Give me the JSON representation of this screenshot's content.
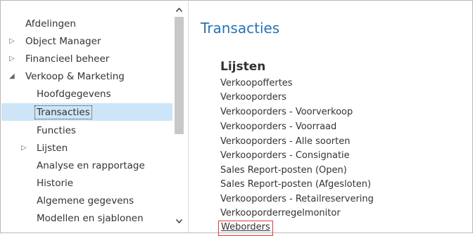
{
  "sidebar": {
    "items": [
      {
        "label": "Afdelingen",
        "expander": ""
      },
      {
        "label": "Object Manager",
        "expander": "▷"
      },
      {
        "label": "Financieel beheer",
        "expander": "▷"
      },
      {
        "label": "Verkoop & Marketing",
        "expander": "◢"
      },
      {
        "label": "Hoofdgegevens",
        "expander": ""
      },
      {
        "label": "Transacties",
        "expander": "",
        "selected": true
      },
      {
        "label": "Functies",
        "expander": ""
      },
      {
        "label": "Lijsten",
        "expander": "▷"
      },
      {
        "label": "Analyse en rapportage",
        "expander": ""
      },
      {
        "label": "Historie",
        "expander": ""
      },
      {
        "label": "Algemene gegevens",
        "expander": ""
      },
      {
        "label": "Modellen en sjablonen",
        "expander": ""
      }
    ],
    "scroll_up_icon": "chevron-up-icon",
    "scroll_down_icon": "chevron-down-icon"
  },
  "main": {
    "title": "Transacties",
    "section_heading": "Lijsten",
    "links": [
      "Verkoopoffertes",
      "Verkooporders",
      "Verkooporders - Voorverkoop",
      "Verkooporders - Voorraad",
      "Verkooporders - Alle soorten",
      "Verkooporders - Consignatie",
      "Sales Report-posten (Open)",
      "Sales Report-posten (Afgesloten)",
      "Verkooporders - Retailreservering",
      "Verkooporderregelmonitor",
      "Weborders"
    ],
    "highlighted_link": "Weborders"
  },
  "colors": {
    "title_blue": "#2672b5",
    "selection_bg": "#cde5f7",
    "highlight_border": "#e23a3a"
  }
}
